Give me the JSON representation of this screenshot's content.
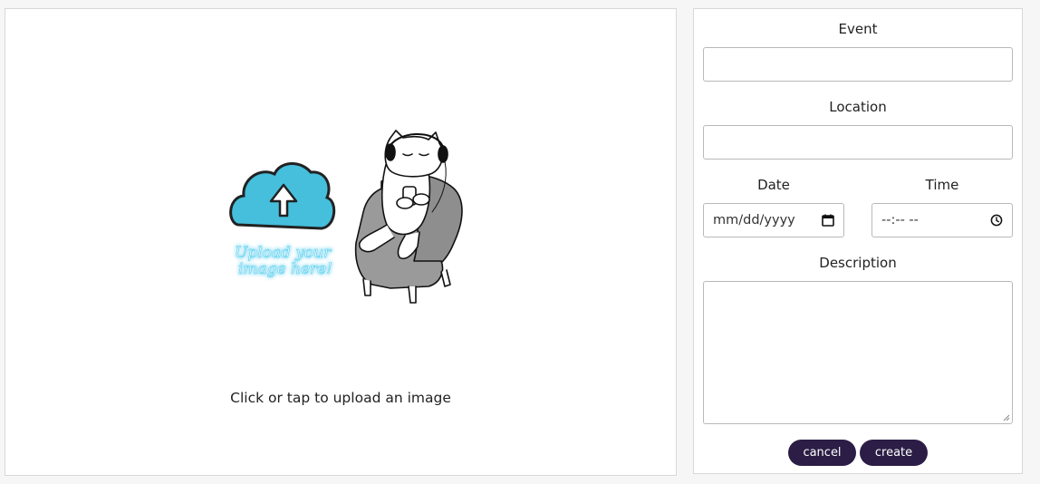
{
  "upload": {
    "caption": "Click or tap to upload an image",
    "art_text_line1": "Upload your",
    "art_text_line2": "image here!",
    "cloud_color": "#45bfdc"
  },
  "form": {
    "event_label": "Event",
    "event_value": "",
    "location_label": "Location",
    "location_value": "",
    "date_label": "Date",
    "date_placeholder": "mm/dd/yyyy",
    "time_label": "Time",
    "time_placeholder": "--:-- --",
    "description_label": "Description",
    "description_value": "",
    "cancel_label": "cancel",
    "create_label": "create"
  },
  "colors": {
    "button_bg": "#2b1d45",
    "button_text": "#ffffff",
    "border": "#b9b9b9"
  },
  "icons": {
    "date": "calendar-icon",
    "time": "clock-icon",
    "upload": "cloud-upload-icon"
  }
}
